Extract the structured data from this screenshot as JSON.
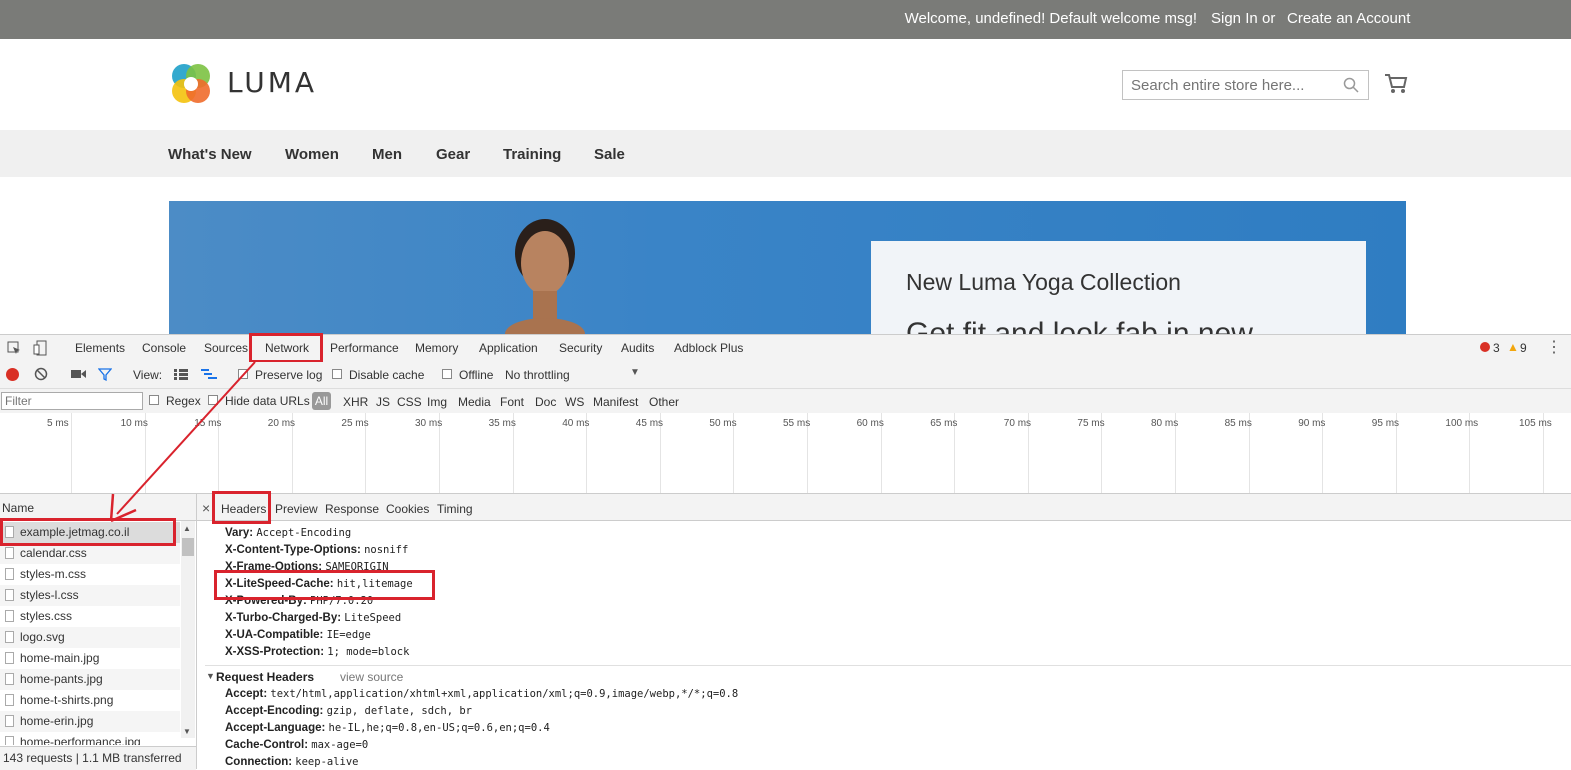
{
  "store": {
    "welcome": "Welcome, undefined! Default welcome msg!",
    "sign_in": "Sign In",
    "or": "or",
    "create_account": "Create an Account",
    "logo_text": "LUMA",
    "search_placeholder": "Search entire store here...",
    "nav": [
      "What's New",
      "Women",
      "Men",
      "Gear",
      "Training",
      "Sale"
    ],
    "hero": {
      "title": "New Luma Yoga Collection",
      "subtitle": "Get fit and look fab in new"
    }
  },
  "devtools": {
    "tabs": [
      "Elements",
      "Console",
      "Sources",
      "Network",
      "Performance",
      "Memory",
      "Application",
      "Security",
      "Audits",
      "Adblock Plus"
    ],
    "active_tab": "Network",
    "errors": "3",
    "warnings": "9",
    "toolbar": {
      "view_label": "View:",
      "preserve_log": "Preserve log",
      "disable_cache": "Disable cache",
      "offline": "Offline",
      "throttling": "No throttling"
    },
    "filter": {
      "placeholder": "Filter",
      "regex": "Regex",
      "hide_data_urls": "Hide data URLs",
      "types": [
        "All",
        "XHR",
        "JS",
        "CSS",
        "Img",
        "Media",
        "Font",
        "Doc",
        "WS",
        "Manifest",
        "Other"
      ]
    },
    "timeline_ticks": [
      "5 ms",
      "10 ms",
      "15 ms",
      "20 ms",
      "25 ms",
      "30 ms",
      "35 ms",
      "40 ms",
      "45 ms",
      "50 ms",
      "55 ms",
      "60 ms",
      "65 ms",
      "70 ms",
      "75 ms",
      "80 ms",
      "85 ms",
      "90 ms",
      "95 ms",
      "100 ms",
      "105 ms"
    ],
    "name_header": "Name",
    "requests": [
      "example.jetmag.co.il",
      "calendar.css",
      "styles-m.css",
      "styles-l.css",
      "styles.css",
      "logo.svg",
      "home-main.jpg",
      "home-pants.jpg",
      "home-t-shirts.png",
      "home-erin.jpg",
      "home-performance.jpg"
    ],
    "status": "143 requests | 1.1 MB transferred",
    "detail_tabs": [
      "Headers",
      "Preview",
      "Response",
      "Cookies",
      "Timing"
    ],
    "response_headers": [
      {
        "name": "Vary:",
        "value": "Accept-Encoding"
      },
      {
        "name": "X-Content-Type-Options:",
        "value": "nosniff"
      },
      {
        "name": "X-Frame-Options:",
        "value": "SAMEORIGIN"
      },
      {
        "name": "X-LiteSpeed-Cache:",
        "value": "hit,litemage"
      },
      {
        "name": "X-Powered-By:",
        "value": "PHP/7.0.20"
      },
      {
        "name": "X-Turbo-Charged-By:",
        "value": "LiteSpeed"
      },
      {
        "name": "X-UA-Compatible:",
        "value": "IE=edge"
      },
      {
        "name": "X-XSS-Protection:",
        "value": "1; mode=block"
      }
    ],
    "request_headers_title": "Request Headers",
    "view_source": "view source",
    "request_headers": [
      {
        "name": "Accept:",
        "value": "text/html,application/xhtml+xml,application/xml;q=0.9,image/webp,*/*;q=0.8"
      },
      {
        "name": "Accept-Encoding:",
        "value": "gzip, deflate, sdch, br"
      },
      {
        "name": "Accept-Language:",
        "value": "he-IL,he;q=0.8,en-US;q=0.6,en;q=0.4"
      },
      {
        "name": "Cache-Control:",
        "value": "max-age=0"
      },
      {
        "name": "Connection:",
        "value": "keep-alive"
      }
    ]
  },
  "colors": {
    "annotation_red": "#d9232d",
    "topbar": "#7a7b78"
  }
}
